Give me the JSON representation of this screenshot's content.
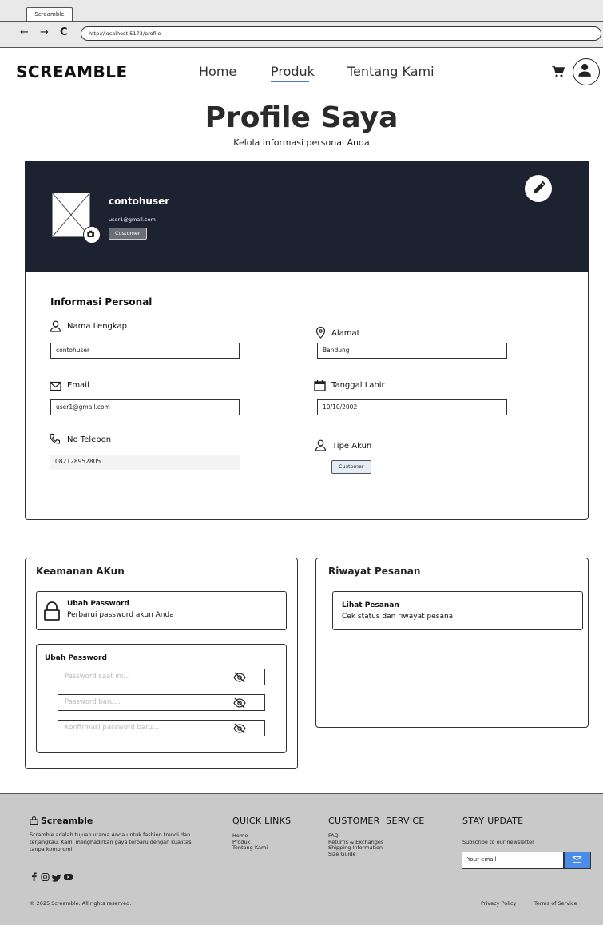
{
  "browser": {
    "tab_title": "Screamble",
    "url": "http://localhost:5173/profile",
    "back": "←",
    "forward": "→",
    "reload": "C"
  },
  "header": {
    "brand": "SCREAMBLE",
    "nav": [
      "Home",
      "Produk",
      "Tentang Kami"
    ],
    "active_nav": "Produk",
    "accent_color": "#4a7be0"
  },
  "page": {
    "title": "Profile Saya",
    "subtitle": "Kelola informasi personal Anda"
  },
  "profile_banner": {
    "username": "contohuser",
    "email": "user1@gmail.com",
    "role": "Customer",
    "background_color": "#1c2230"
  },
  "personal_info": {
    "title": "Informasi Personal",
    "full_name": {
      "label": "Nama Lengkap",
      "value": "contohuser"
    },
    "address": {
      "label": "Alamat",
      "value": "Bandung"
    },
    "email": {
      "label": "Email",
      "value": "user1@gmail.com"
    },
    "birth_date": {
      "label": "Tanggal Lahir",
      "value": "10/10/2002"
    },
    "phone": {
      "label": "No Telepon",
      "value": "082128952805"
    },
    "account_type": {
      "label": "Tipe Akun",
      "value": "Customer"
    }
  },
  "security": {
    "title": "Keamanan AKun",
    "change_password_card": {
      "title": "Ubah Password",
      "description": "Perbarui password akun Anda"
    },
    "form": {
      "title": "Ubah Password",
      "current_placeholder": "Password saat ini...",
      "new_placeholder": "Password baru...",
      "confirm_placeholder": "Konfirmasi password baru..."
    }
  },
  "orders": {
    "title": "Riwayat Pesanan",
    "card": {
      "title": "Lihat Pesanan",
      "description": "Cek status dan riwayat pesana"
    }
  },
  "footer": {
    "brand": "Screamble",
    "about": "Scramble adalah tujuan utama Anda untuk fashion trendi dan terjangkau. Kami menghadirkan gaya terbaru dengan kualitas tanpa kompromi.",
    "quick_links_title": "QUICK LINKS",
    "quick_links": [
      "Home",
      "Produk",
      "Tentang Kami"
    ],
    "customer_service_title": "CUSTOMER  SERVICE",
    "customer_service": [
      "FAQ",
      "Returns & Exchanges",
      "Shipping Information",
      "Size Guide"
    ],
    "stay_update_title": "STAY UPDATE",
    "newsletter_text": "Subscribe to our newsletter",
    "email_placeholder": "Your email",
    "copyright": "© 2025 Screamble. All rights reserved.",
    "privacy": "Privacy Policy",
    "terms": "Terms of Service",
    "send_button_color": "#4c8be8"
  }
}
